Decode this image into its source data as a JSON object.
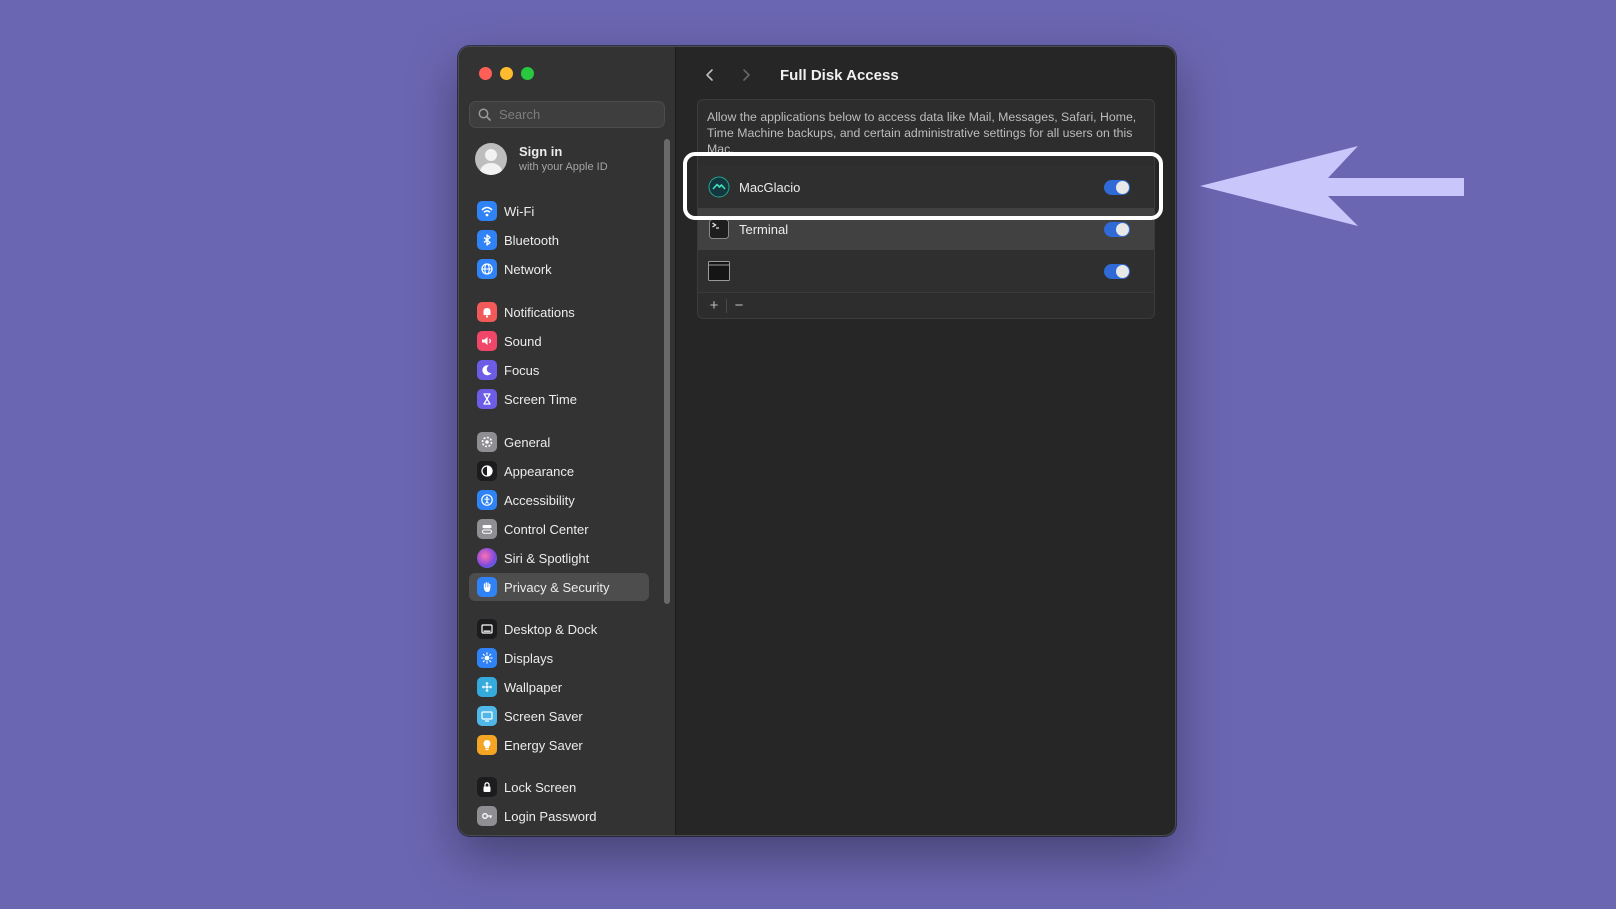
{
  "window": {
    "title": "Full Disk Access"
  },
  "search": {
    "placeholder": "Search"
  },
  "account": {
    "title": "Sign in",
    "subtitle": "with your Apple ID"
  },
  "sidebar": {
    "items": [
      {
        "label": "Wi-Fi",
        "icon": "wifi-icon",
        "color": "#2f83f6"
      },
      {
        "label": "Bluetooth",
        "icon": "bluetooth-icon",
        "color": "#2f83f6"
      },
      {
        "label": "Network",
        "icon": "globe-icon",
        "color": "#2f83f6"
      },
      {
        "label": "Notifications",
        "icon": "bell-icon",
        "color": "#f25a5a"
      },
      {
        "label": "Sound",
        "icon": "speaker-icon",
        "color": "#f0466a"
      },
      {
        "label": "Focus",
        "icon": "moon-icon",
        "color": "#6d5ce6"
      },
      {
        "label": "Screen Time",
        "icon": "hourglass-icon",
        "color": "#6d5ce6"
      },
      {
        "label": "General",
        "icon": "gear-icon",
        "color": "#8e8e93"
      },
      {
        "label": "Appearance",
        "icon": "appearance-icon",
        "color": "#1c1c1e"
      },
      {
        "label": "Accessibility",
        "icon": "accessibility-icon",
        "color": "#2f83f6"
      },
      {
        "label": "Control Center",
        "icon": "control-center-icon",
        "color": "#8e8e93"
      },
      {
        "label": "Siri & Spotlight",
        "icon": "siri-icon",
        "color": "#b44ad0"
      },
      {
        "label": "Privacy & Security",
        "icon": "hand-icon",
        "color": "#2f83f6",
        "active": true
      },
      {
        "label": "Desktop & Dock",
        "icon": "dock-icon",
        "color": "#1c1c1e"
      },
      {
        "label": "Displays",
        "icon": "sun-icon",
        "color": "#2f83f6"
      },
      {
        "label": "Wallpaper",
        "icon": "wallpaper-icon",
        "color": "#35aadc"
      },
      {
        "label": "Screen Saver",
        "icon": "screensaver-icon",
        "color": "#4fb8e8"
      },
      {
        "label": "Energy Saver",
        "icon": "bulb-icon",
        "color": "#f5a524"
      },
      {
        "label": "Lock Screen",
        "icon": "lock-icon",
        "color": "#1c1c1e"
      },
      {
        "label": "Login Password",
        "icon": "key-icon",
        "color": "#8e8e93"
      }
    ]
  },
  "main": {
    "title": "Full Disk Access",
    "description": "Allow the applications below to access data like Mail, Messages, Safari, Home, Time Machine backups, and certain administrative settings for all users on this Mac.",
    "apps": [
      {
        "name": "MacGlacio",
        "icon": "macglacio-icon",
        "enabled": true
      },
      {
        "name": "Terminal",
        "icon": "terminal-icon",
        "enabled": true
      },
      {
        "name": "",
        "icon": "window-app-icon",
        "enabled": true
      }
    ],
    "footer": {
      "add": "+",
      "remove": "−"
    }
  },
  "annotation": {
    "highlight_color": "#ffffff",
    "arrow_color": "#c9c6fb"
  }
}
